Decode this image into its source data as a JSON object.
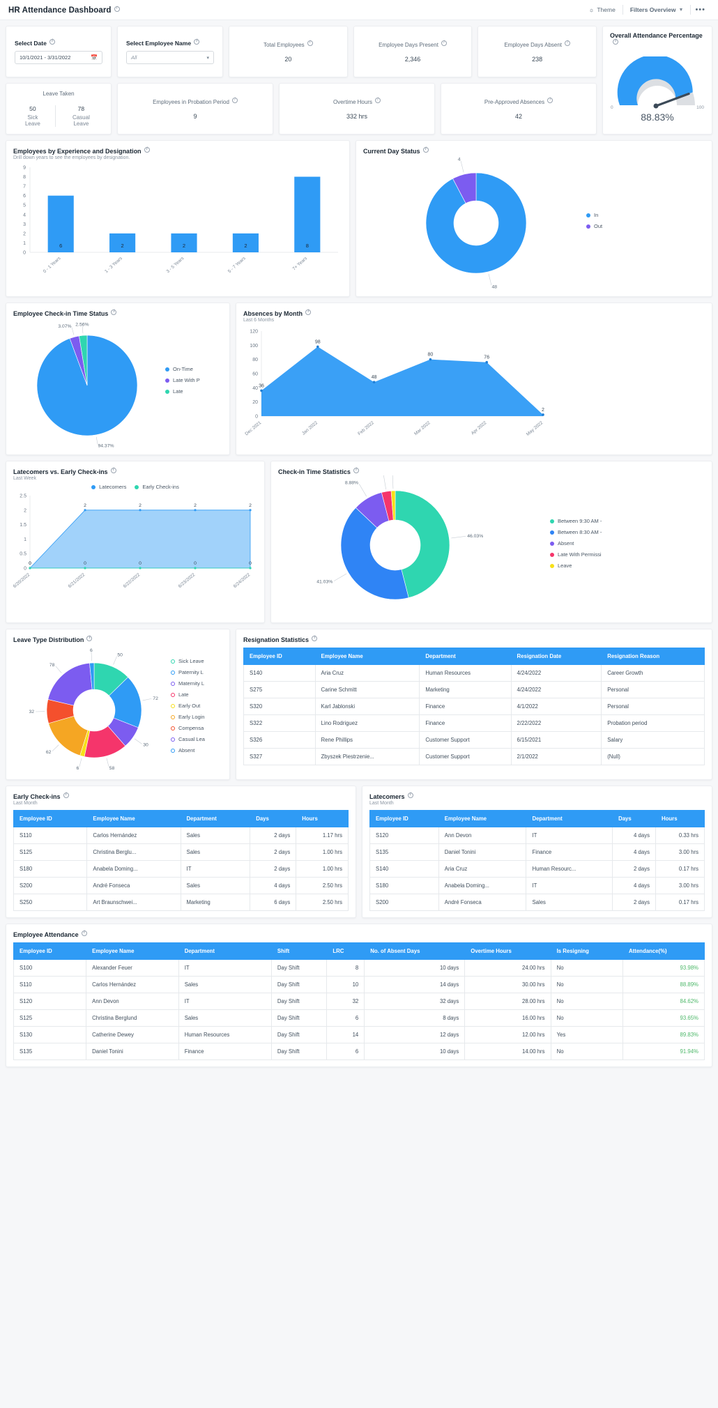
{
  "topbar": {
    "title": "HR Attendance Dashboard",
    "theme_label": "Theme",
    "filters_label": "Filters Overview",
    "more_label": "•••",
    "theme_icon": "sun-icon",
    "chevron_icon": "chevron-down-icon"
  },
  "filters": {
    "date": {
      "label": "Select Date",
      "value": "10/1/2021 - 3/31/2022",
      "icon": "calendar-icon"
    },
    "employee": {
      "label": "Select Employee Name",
      "value": "All",
      "icon": "chevron-down-icon"
    }
  },
  "kpis": [
    {
      "title": "Total Employees",
      "value": "20"
    },
    {
      "title": "Employee Days Present",
      "value": "2,346"
    },
    {
      "title": "Employee Days Absent",
      "value": "238"
    },
    {
      "title": "Employees in Probation Period",
      "value": "9"
    },
    {
      "title": "Overtime Hours",
      "value": "332 hrs"
    },
    {
      "title": "Pre-Approved Absences",
      "value": "42"
    }
  ],
  "leave_taken": {
    "title": "Leave Taken",
    "items": [
      {
        "value": "50",
        "label": "Sick Leave"
      },
      {
        "value": "78",
        "label": "Casual Leave"
      }
    ]
  },
  "gauge": {
    "title": "Overall Attendance Percentage",
    "min_label": "0",
    "max_label": "100",
    "value_label": "88.83%",
    "value": 88.83,
    "color": "#2f9bf5",
    "track_color": "#dcdfe3"
  },
  "chart_data": [
    {
      "id": "employees-by-experience",
      "type": "bar",
      "title": "Employees by Experience and Designation",
      "subtitle": "Drill down years to see the employees by designation.",
      "categories": [
        "0 - 1 Years",
        "1 - 3 Years",
        "3 - 5 Years",
        "5 - 7 Years",
        "7+ Years"
      ],
      "values": [
        6,
        2,
        2,
        2,
        8
      ],
      "ylim": [
        0,
        9
      ],
      "yticks": [
        0,
        1,
        2,
        3,
        4,
        5,
        6,
        7,
        8,
        9
      ],
      "color": "#2f9bf5",
      "xlabel": "",
      "ylabel": ""
    },
    {
      "id": "current-day-status",
      "type": "pie",
      "title": "Current Day Status",
      "labels": [
        "In",
        "Out"
      ],
      "values": [
        48,
        4
      ],
      "data_labels": [
        "48",
        "4"
      ],
      "colors": [
        "#2f9bf5",
        "#7c5cf0"
      ],
      "legend_position": "right",
      "donut": true
    },
    {
      "id": "checkin-time-status",
      "type": "pie",
      "title": "Employee Check-in Time Status",
      "labels": [
        "On-Time",
        "Late With P",
        "Late"
      ],
      "values": [
        94.37,
        3.07,
        2.56
      ],
      "data_labels": [
        "94.37%",
        "3.07%",
        "2.56%"
      ],
      "colors": [
        "#2f9bf5",
        "#7c5cf0",
        "#2fd6b0"
      ],
      "legend_position": "right",
      "donut": false
    },
    {
      "id": "absences-by-month",
      "type": "area",
      "title": "Absences by Month",
      "subtitle": "Last 6 Months",
      "categories": [
        "Dec 2021",
        "Jan 2022",
        "Feb 2022",
        "Mar 2022",
        "Apr 2022",
        "May 2022"
      ],
      "values": [
        36,
        98,
        48,
        80,
        76,
        2
      ],
      "ylim": [
        0,
        120
      ],
      "yticks": [
        0,
        20,
        40,
        60,
        80,
        100,
        120
      ],
      "color": "#2f9bf5"
    },
    {
      "id": "latecomers-vs-early",
      "type": "area",
      "title": "Latecomers vs. Early Check-ins",
      "subtitle": "Last Week",
      "categories": [
        "6/20/2022",
        "6/21/2022",
        "6/22/2022",
        "6/23/2022",
        "6/24/2022"
      ],
      "series": [
        {
          "name": "Latecomers",
          "values": [
            0,
            2,
            2,
            2,
            2
          ],
          "color": "#2f9bf5"
        },
        {
          "name": "Early Check-ins",
          "values": [
            0,
            0,
            0,
            0,
            0
          ],
          "color": "#2fd6b0"
        }
      ],
      "ylim": [
        0,
        2.5
      ],
      "yticks": [
        0,
        0.5,
        1,
        1.5,
        2,
        2.5
      ],
      "legend_position": "top"
    },
    {
      "id": "checkin-time-statistics",
      "type": "pie",
      "title": "Check-in Time Statistics",
      "labels": [
        "Between 9:30 AM -",
        "Between 8:30 AM -",
        "Absent",
        "Late With Permissi",
        "Leave"
      ],
      "values": [
        46.03,
        41.03,
        8.88,
        2.84,
        1.21
      ],
      "data_labels": [
        "46.03%",
        "41.03%",
        "8.88%",
        "2.84%",
        "1.21%"
      ],
      "colors": [
        "#2fd6b0",
        "#2f84f5",
        "#7c5cf0",
        "#f5356b",
        "#f7e018"
      ],
      "legend_position": "right",
      "donut": true
    },
    {
      "id": "leave-type-distribution",
      "type": "pie",
      "title": "Leave Type Distribution",
      "labels": [
        "Sick Leave",
        "Paternity L",
        "Maternity L",
        "Late",
        "Early Out",
        "Early Login",
        "Compensa",
        "Casual Lea",
        "Absent"
      ],
      "values": [
        50,
        72,
        30,
        58,
        6,
        62,
        32,
        78,
        6
      ],
      "data_labels": [
        "50",
        "72",
        "30",
        "58",
        "6",
        "62",
        "32",
        "78",
        "6"
      ],
      "colors": [
        "#2fd6b0",
        "#2f9bf5",
        "#7c5cf0",
        "#f5356b",
        "#f7e018",
        "#f5a623",
        "#f4502d",
        "#7c5cf0",
        "#2f9bf5"
      ],
      "legend_position": "right",
      "donut": true
    }
  ],
  "tables": {
    "resignation": {
      "title": "Resignation Statistics",
      "columns": [
        "Employee ID",
        "Employee Name",
        "Department",
        "Resignation Date",
        "Resignation Reason"
      ],
      "rows": [
        [
          "S140",
          "Aria Cruz",
          "Human Resources",
          "4/24/2022",
          "Career Growth"
        ],
        [
          "S275",
          "Carine Schmitt",
          "Marketing",
          "4/24/2022",
          "Personal"
        ],
        [
          "S320",
          "Karl Jablonski",
          "Finance",
          "4/1/2022",
          "Personal"
        ],
        [
          "S322",
          "Lino Rodriguez",
          "Finance",
          "2/22/2022",
          "Probation period"
        ],
        [
          "S326",
          "Rene Phillips",
          "Customer Support",
          "6/15/2021",
          "Salary"
        ],
        [
          "S327",
          "Zbyszek Piestrzenie...",
          "Customer Support",
          "2/1/2022",
          "(Null)"
        ]
      ]
    },
    "early_checkins": {
      "title": "Early Check-ins",
      "subtitle": "Last Month",
      "columns": [
        "Employee ID",
        "Employee Name",
        "Department",
        "Days",
        "Hours"
      ],
      "rows": [
        [
          "S110",
          "Carlos Hernández",
          "Sales",
          "2 days",
          "1.17 hrs"
        ],
        [
          "S125",
          "Christina Berglu...",
          "Sales",
          "2 days",
          "1.00 hrs"
        ],
        [
          "S180",
          "Anabela Doming...",
          "IT",
          "2 days",
          "1.00 hrs"
        ],
        [
          "S200",
          "André Fonseca",
          "Sales",
          "4 days",
          "2.50 hrs"
        ],
        [
          "S250",
          "Art Braunschwei...",
          "Marketing",
          "6 days",
          "2.50 hrs"
        ]
      ]
    },
    "latecomers": {
      "title": "Latecomers",
      "subtitle": "Last Month",
      "columns": [
        "Employee ID",
        "Employee Name",
        "Department",
        "Days",
        "Hours"
      ],
      "rows": [
        [
          "S120",
          "Ann Devon",
          "IT",
          "4 days",
          "0.33 hrs"
        ],
        [
          "S135",
          "Daniel Tonini",
          "Finance",
          "4 days",
          "3.00 hrs"
        ],
        [
          "S140",
          "Aria Cruz",
          "Human Resourc...",
          "2 days",
          "0.17 hrs"
        ],
        [
          "S180",
          "Anabela Doming...",
          "IT",
          "4 days",
          "3.00 hrs"
        ],
        [
          "S200",
          "André Fonseca",
          "Sales",
          "2 days",
          "0.17 hrs"
        ]
      ]
    },
    "employee_attendance": {
      "title": "Employee Attendance",
      "columns": [
        "Employee ID",
        "Employee Name",
        "Department",
        "Shift",
        "LRC",
        "No. of Absent Days",
        "Overtime Hours",
        "Is Resigning",
        "Attendance(%)"
      ],
      "rows": [
        [
          "S100",
          "Alexander Feuer",
          "IT",
          "Day Shift",
          "8",
          "10 days",
          "24.00 hrs",
          "No",
          "93.98%"
        ],
        [
          "S110",
          "Carlos Hernández",
          "Sales",
          "Day Shift",
          "10",
          "14 days",
          "30.00 hrs",
          "No",
          "88.89%"
        ],
        [
          "S120",
          "Ann Devon",
          "IT",
          "Day Shift",
          "32",
          "32 days",
          "28.00 hrs",
          "No",
          "84.62%"
        ],
        [
          "S125",
          "Christina Berglund",
          "Sales",
          "Day Shift",
          "6",
          "8 days",
          "16.00 hrs",
          "No",
          "93.65%"
        ],
        [
          "S130",
          "Catherine Dewey",
          "Human Resources",
          "Day Shift",
          "14",
          "12 days",
          "12.00 hrs",
          "Yes",
          "89.83%"
        ],
        [
          "S135",
          "Daniel Tonini",
          "Finance",
          "Day Shift",
          "6",
          "10 days",
          "14.00 hrs",
          "No",
          "91.94%"
        ]
      ]
    }
  }
}
